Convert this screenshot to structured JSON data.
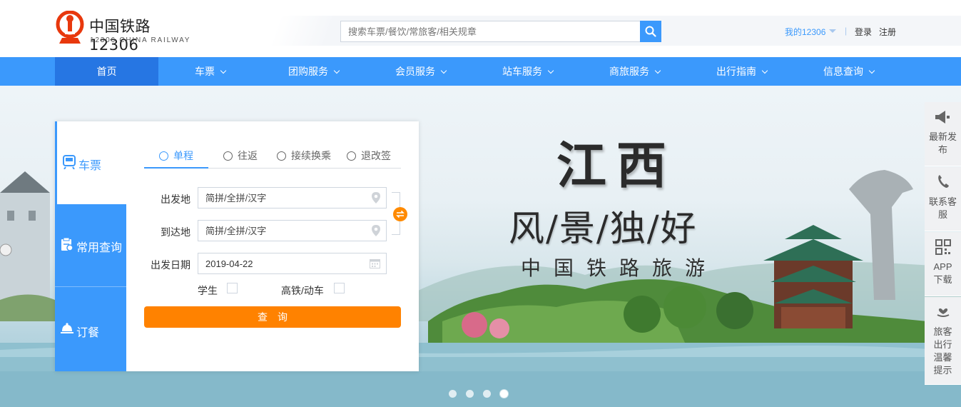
{
  "header": {
    "logo_title": "中国铁路12306",
    "logo_subtitle": "12306 CHINA RAILWAY",
    "search_placeholder": "搜索车票/餐饮/常旅客/相关规章",
    "my12306": "我的12306",
    "separator": "|",
    "login": "登录",
    "register": "注册"
  },
  "nav": {
    "items": [
      {
        "label": "首页"
      },
      {
        "label": "车票"
      },
      {
        "label": "团购服务"
      },
      {
        "label": "会员服务"
      },
      {
        "label": "站车服务"
      },
      {
        "label": "商旅服务"
      },
      {
        "label": "出行指南"
      },
      {
        "label": "信息查询"
      }
    ]
  },
  "booking": {
    "side_tabs": [
      {
        "label": "车票",
        "icon": "train-icon"
      },
      {
        "label": "常用查询",
        "icon": "clipboard-icon"
      },
      {
        "label": "订餐",
        "icon": "food-cloche-icon"
      }
    ],
    "trip_tabs": [
      {
        "label": "单程"
      },
      {
        "label": "往返"
      },
      {
        "label": "接续换乘"
      },
      {
        "label": "退改签"
      }
    ],
    "from_label": "出发地",
    "from_placeholder": "简拼/全拼/汉字",
    "to_label": "到达地",
    "to_placeholder": "简拼/全拼/汉字",
    "date_label": "出发日期",
    "date_value": "2019-04-22",
    "student_label": "学生",
    "highspeed_label": "高铁/动车",
    "query_button": "查询"
  },
  "hero": {
    "line1": "江西",
    "line2": "风/景/独/好",
    "line3": "中国铁路旅游",
    "slide_count": 4,
    "active_slide": 4
  },
  "float_bar": {
    "items": [
      {
        "label": "最新发布",
        "icon": "megaphone-icon"
      },
      {
        "label": "联系客服",
        "icon": "phone-icon"
      },
      {
        "label": "APP下载",
        "icon": "qrcode-icon"
      },
      {
        "label": "旅客出行温馨提示",
        "icon": "heart-hand-icon"
      }
    ]
  },
  "colors": {
    "brand_blue": "#3b99fc",
    "nav_active": "#2676e3",
    "query_orange": "#ff8200",
    "logo_red": "#e8380d"
  }
}
